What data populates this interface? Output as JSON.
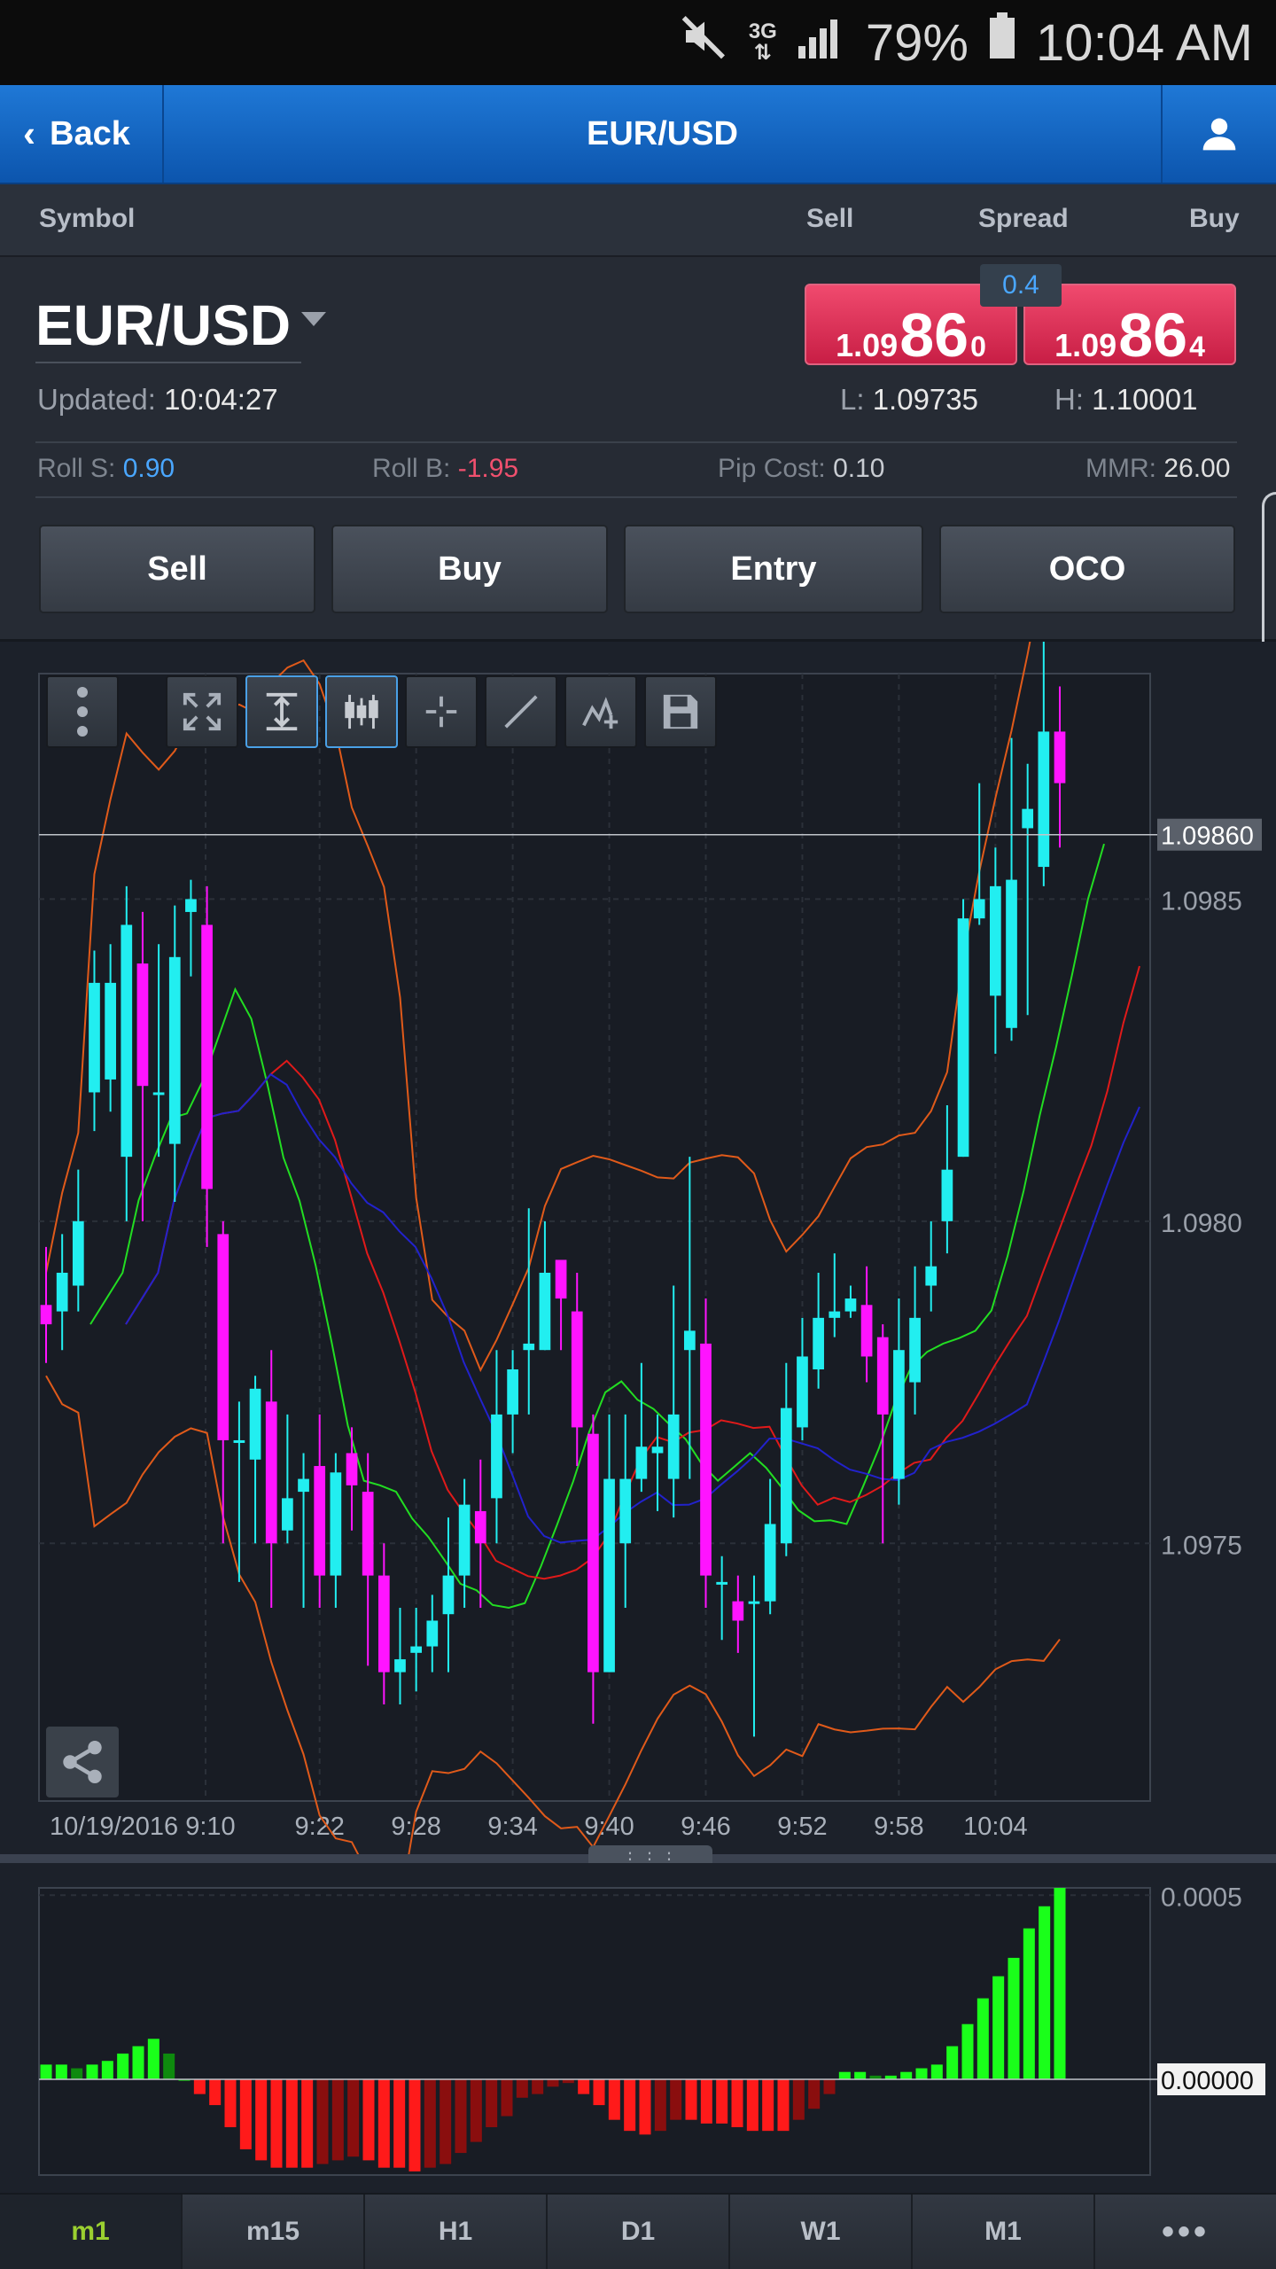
{
  "status_bar": {
    "battery": "79%",
    "time": "10:04 AM",
    "network": "3G"
  },
  "nav": {
    "back_label": "Back",
    "title": "EUR/USD"
  },
  "header": {
    "symbol": "Symbol",
    "sell": "Sell",
    "spread": "Spread",
    "buy": "Buy"
  },
  "quote": {
    "symbol": "EUR/USD",
    "updated_label": "Updated:",
    "updated_time": "10:04:27",
    "sell_price": {
      "prefix": "1.09",
      "big": "86",
      "suffix": "0"
    },
    "buy_price": {
      "prefix": "1.09",
      "big": "86",
      "suffix": "4"
    },
    "spread": "0.4",
    "low_label": "L:",
    "low": "1.09735",
    "high_label": "H:",
    "high": "1.10001"
  },
  "stats": {
    "roll_s_label": "Roll S:",
    "roll_s": "0.90",
    "roll_b_label": "Roll B:",
    "roll_b": "-1.95",
    "pip_cost_label": "Pip Cost:",
    "pip_cost": "0.10",
    "mmr_label": "MMR:",
    "mmr": "26.00"
  },
  "actions": {
    "sell": "Sell",
    "buy": "Buy",
    "entry": "Entry",
    "oco": "OCO"
  },
  "toolbar": [
    "menu-icon",
    "fullscreen-icon",
    "fit-vertical-icon",
    "candlestick-icon",
    "crosshair-icon",
    "line-tool-icon",
    "indicator-icon",
    "save-icon"
  ],
  "colors": {
    "bull": "#22eef0",
    "bear": "#ff14ff",
    "sell_btn": "#e0305a",
    "spread_text": "#4aa7ff",
    "active_tab": "#9bd030",
    "roll_s": "#4aa7ff",
    "roll_b": "#f0506e"
  },
  "chart_data": [
    {
      "type": "candlestick",
      "title": "",
      "x": [
        "10/19/2016 9:10",
        "9:22",
        "9:28",
        "9:34",
        "9:40",
        "9:46",
        "9:52",
        "9:58",
        "10:04"
      ],
      "y_ticks": [
        "1.0985",
        "1.0980",
        "1.0975"
      ],
      "current_price_label": "1.09860",
      "current_price": 1.0986,
      "ylim": [
        1.0971,
        1.09885
      ],
      "candles": [
        [
          1.09787,
          1.09784,
          1.09796,
          1.09778
        ],
        [
          1.09786,
          1.09792,
          1.09798,
          1.0978
        ],
        [
          1.0979,
          1.098,
          1.09808,
          1.09786
        ],
        [
          1.0982,
          1.09837,
          1.09842,
          1.09814
        ],
        [
          1.09822,
          1.09837,
          1.09843,
          1.09817
        ],
        [
          1.0981,
          1.09846,
          1.09852,
          1.098
        ],
        [
          1.0984,
          1.09821,
          1.09848,
          1.098
        ],
        [
          1.0982,
          1.0982,
          1.09843,
          1.0981
        ],
        [
          1.09812,
          1.09841,
          1.09849,
          1.09803
        ],
        [
          1.09848,
          1.0985,
          1.09853,
          1.09838
        ],
        [
          1.09846,
          1.09805,
          1.09852,
          1.09796
        ],
        [
          1.09798,
          1.09766,
          1.098,
          1.0975
        ],
        [
          1.09766,
          1.09766,
          1.09772,
          1.09744
        ],
        [
          1.09763,
          1.09774,
          1.09776,
          1.0975
        ],
        [
          1.09772,
          1.0975,
          1.0978,
          1.0974
        ],
        [
          1.09752,
          1.09757,
          1.0977,
          1.0975
        ],
        [
          1.09758,
          1.0976,
          1.09764,
          1.0974
        ],
        [
          1.09762,
          1.09745,
          1.0977,
          1.0974
        ],
        [
          1.09745,
          1.09761,
          1.09764,
          1.0974
        ],
        [
          1.09764,
          1.09759,
          1.09768,
          1.09752
        ],
        [
          1.09758,
          1.09745,
          1.09764,
          1.09731
        ],
        [
          1.09745,
          1.0973,
          1.0975,
          1.09725
        ],
        [
          1.0973,
          1.09732,
          1.0974,
          1.09725
        ],
        [
          1.09733,
          1.09734,
          1.0974,
          1.09727
        ],
        [
          1.09734,
          1.09738,
          1.09742,
          1.0973
        ],
        [
          1.09739,
          1.09745,
          1.09754,
          1.0973
        ],
        [
          1.09745,
          1.09756,
          1.0976,
          1.0974
        ],
        [
          1.09755,
          1.0975,
          1.09763,
          1.0974
        ],
        [
          1.09757,
          1.0977,
          1.0978,
          1.0975
        ],
        [
          1.0977,
          1.09777,
          1.0978,
          1.09764
        ],
        [
          1.0978,
          1.09781,
          1.09802,
          1.0977
        ],
        [
          1.0978,
          1.09792,
          1.098,
          1.0978
        ],
        [
          1.09794,
          1.09788,
          1.0979,
          1.0978
        ],
        [
          1.09786,
          1.09768,
          1.09792,
          1.09762
        ],
        [
          1.09767,
          1.0973,
          1.0977,
          1.09722
        ],
        [
          1.0973,
          1.0976,
          1.0977,
          1.0973
        ],
        [
          1.0975,
          1.0976,
          1.0977,
          1.0974
        ],
        [
          1.0976,
          1.09765,
          1.09778,
          1.09758
        ],
        [
          1.09764,
          1.09765,
          1.0977,
          1.09755
        ],
        [
          1.0976,
          1.0977,
          1.0979,
          1.09754
        ],
        [
          1.0978,
          1.09783,
          1.0981,
          1.0976
        ],
        [
          1.09781,
          1.09745,
          1.09788,
          1.0974
        ],
        [
          1.09744,
          1.09744,
          1.09748,
          1.09735
        ],
        [
          1.09741,
          1.09738,
          1.09745,
          1.09733
        ],
        [
          1.09741,
          1.09741,
          1.09745,
          1.0972
        ],
        [
          1.09741,
          1.09753,
          1.0976,
          1.09739
        ],
        [
          1.0975,
          1.09771,
          1.09778,
          1.09748
        ],
        [
          1.09768,
          1.09779,
          1.09785,
          1.09766
        ],
        [
          1.09777,
          1.09785,
          1.09792,
          1.09774
        ],
        [
          1.09785,
          1.09786,
          1.09795,
          1.09782
        ],
        [
          1.09786,
          1.09788,
          1.0979,
          1.09785
        ],
        [
          1.09787,
          1.09779,
          1.09793,
          1.09775
        ],
        [
          1.09782,
          1.0977,
          1.09784,
          1.0975
        ],
        [
          1.0976,
          1.0978,
          1.09788,
          1.09756
        ],
        [
          1.09775,
          1.09785,
          1.09793,
          1.0977
        ],
        [
          1.0979,
          1.09793,
          1.098,
          1.09786
        ],
        [
          1.098,
          1.09808,
          1.09818,
          1.09795
        ],
        [
          1.0981,
          1.09847,
          1.0985,
          1.0981
        ],
        [
          1.09847,
          1.0985,
          1.09868,
          1.09846
        ],
        [
          1.09835,
          1.09852,
          1.09858,
          1.09826
        ],
        [
          1.0983,
          1.09853,
          1.09875,
          1.09828
        ],
        [
          1.09861,
          1.09864,
          1.09871,
          1.09832
        ],
        [
          1.09855,
          1.09876,
          1.0989,
          1.09852
        ],
        [
          1.09876,
          1.09868,
          1.09883,
          1.09858
        ]
      ]
    },
    {
      "type": "bar",
      "title": "",
      "y_ticks": [
        "0.0005",
        "0.00000"
      ],
      "current_label": "0.00000",
      "ylim": [
        -0.00026,
        0.00052
      ],
      "values": [
        4e-05,
        4e-05,
        3e-05,
        4e-05,
        5e-05,
        7e-05,
        9e-05,
        0.00011,
        7e-05,
        0.0,
        -4e-05,
        -7e-05,
        -0.00013,
        -0.00019,
        -0.00022,
        -0.00024,
        -0.00024,
        -0.00024,
        -0.00023,
        -0.00022,
        -0.00021,
        -0.00022,
        -0.00024,
        -0.00024,
        -0.00025,
        -0.00024,
        -0.00023,
        -0.0002,
        -0.00017,
        -0.00013,
        -0.0001,
        -5e-05,
        -4e-05,
        -2e-05,
        -1e-05,
        -4e-05,
        -7e-05,
        -0.00011,
        -0.00014,
        -0.00015,
        -0.00014,
        -0.00011,
        -0.00011,
        -0.00012,
        -0.00012,
        -0.00013,
        -0.00014,
        -0.00014,
        -0.00014,
        -0.00011,
        -8e-05,
        -4e-05,
        2e-05,
        2e-05,
        1e-05,
        1e-05,
        2e-05,
        3e-05,
        4e-05,
        9e-05,
        0.00015,
        0.00022,
        0.00028,
        0.00033,
        0.00041,
        0.00047,
        0.00052
      ]
    }
  ],
  "tabs": [
    "m1",
    "m15",
    "H1",
    "D1",
    "W1",
    "M1",
    "•••"
  ]
}
